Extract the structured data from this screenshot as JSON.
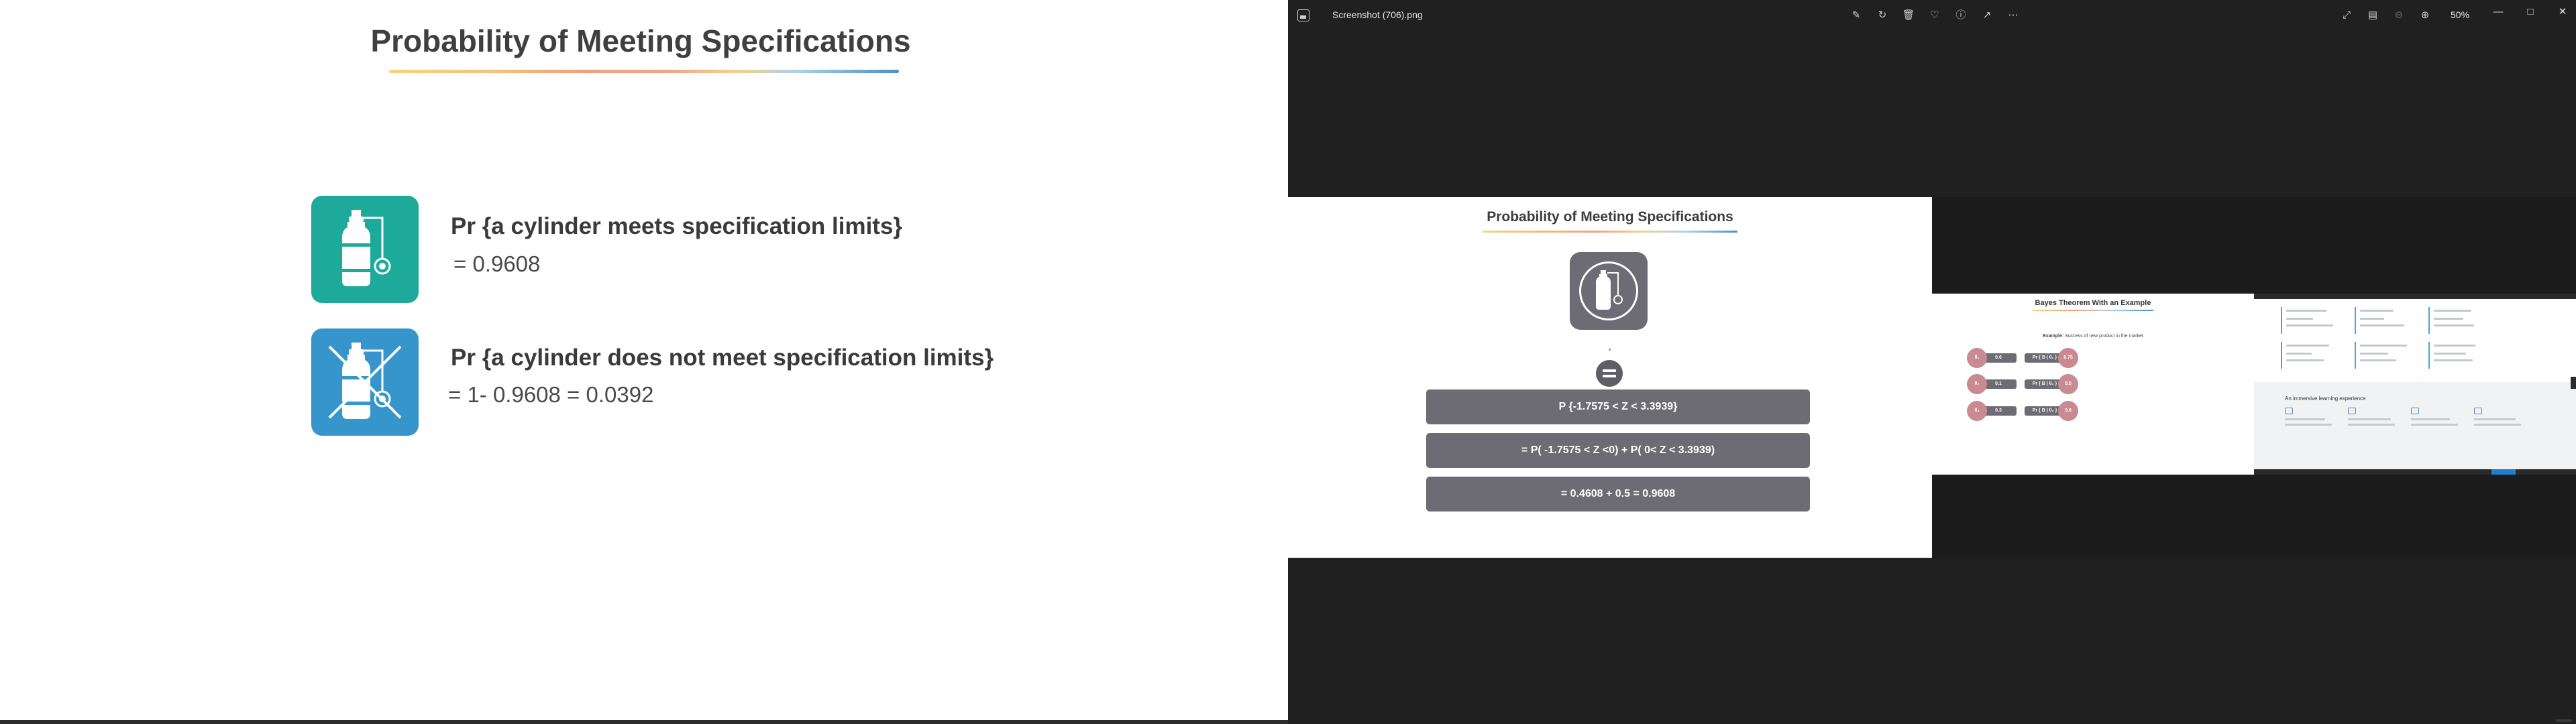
{
  "slide": {
    "title": "Probability of Meeting Specifications",
    "items": [
      {
        "heading": "Pr {a cylinder meets specification limits}",
        "value": "=  0.9608",
        "icon": "gas-cylinder-icon",
        "color": "#1eaa9a"
      },
      {
        "heading": "Pr {a cylinder does not meet specification limits}",
        "value": "= 1- 0.9608 = 0.0392",
        "icon": "gas-cylinder-crossed-icon",
        "color": "#3696cc"
      }
    ]
  },
  "viewer": {
    "file_name": "Screenshot (706).png",
    "zoom": "50%",
    "toolbar_icons": [
      "edit-image-icon",
      "rotate-icon",
      "delete-icon",
      "favorite-icon",
      "info-icon",
      "share-icon",
      "more-icon"
    ],
    "right_icons": [
      "fullscreen-icon",
      "filmstrip-icon",
      "zoom-out-icon",
      "zoom-in-icon"
    ],
    "window_controls": [
      "minimize-icon",
      "maximize-icon",
      "close-icon"
    ],
    "panes": {
      "probability": {
        "title": "Probability of Meeting Specifications",
        "steps": [
          "P {-1.7575 < Z < 3.3939}",
          "= P( -1.7575 < Z <0) + P( 0< Z < 3.3939)",
          "= 0.4608 + 0.5 = 0.9608"
        ]
      },
      "bayes": {
        "title": "Bayes Theorem With an Example",
        "subtitle_bold": "Example:",
        "subtitle_rest": " Success of new product in the market",
        "left_rows": [
          {
            "circle": "θ₁",
            "value": "0.6"
          },
          {
            "circle": "θ₂",
            "value": "0.1"
          },
          {
            "circle": "θ₃",
            "value": "0.3"
          }
        ],
        "right_rows": [
          {
            "label": "Pr { B | θ₁ }",
            "value": "0.75"
          },
          {
            "label": "Pr { B | θ₂ }",
            "value": "0.5"
          },
          {
            "label": "Pr { B | θ₃ }",
            "value": "0.8"
          }
        ]
      },
      "nested": {
        "heading": "An immersive learning experience"
      }
    }
  }
}
